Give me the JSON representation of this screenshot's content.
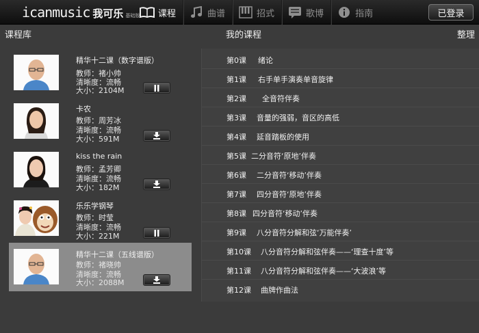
{
  "app": {
    "logo_text": "icanmusic",
    "logo_cn": "我可乐",
    "logo_sub": "基础版"
  },
  "nav": [
    {
      "label": "课程",
      "icon": "book-icon",
      "active": true
    },
    {
      "label": "曲谱",
      "icon": "music-note-icon",
      "active": false
    },
    {
      "label": "招式",
      "icon": "piano-keys-icon",
      "active": false
    },
    {
      "label": "歌博",
      "icon": "list-icon",
      "active": false
    },
    {
      "label": "指南",
      "icon": "info-icon",
      "active": false
    }
  ],
  "login_label": "已登录",
  "headers": {
    "library": "课程库",
    "my_courses": "我的课程",
    "organize": "整理"
  },
  "courses": [
    {
      "title": "精华十二课（数字谱版）",
      "teacher": "教师：褚小帅",
      "quality": "清晰度：流畅",
      "size": "大小：2104M",
      "action": "pause",
      "action_icon": "pause-icon",
      "selected": false
    },
    {
      "title": "卡农",
      "teacher": "教师：周芳冰",
      "quality": "清晰度：流畅",
      "size": "大小：591M",
      "action": "download",
      "action_icon": "download-icon",
      "selected": false
    },
    {
      "title": "kiss the rain",
      "teacher": "教师：孟芳卿",
      "quality": "清晰度：流畅",
      "size": "大小：182M",
      "action": "download",
      "action_icon": "download-icon",
      "selected": false
    },
    {
      "title": "乐乐学钢琴",
      "teacher": "教师：时莹",
      "quality": "清晰度：流畅",
      "size": "大小：221M",
      "action": "pause",
      "action_icon": "pause-icon",
      "selected": false
    },
    {
      "title": "精华十二课（五线谱版）",
      "teacher": "教师：褚晓帅",
      "quality": "清晰度：流畅",
      "size": "大小：2088M",
      "action": "download",
      "action_icon": "download-icon",
      "selected": true
    }
  ],
  "lessons": [
    {
      "num": "第0课",
      "name": "绪论"
    },
    {
      "num": "第1课",
      "name": "右手单手演奏单音旋律"
    },
    {
      "num": "第2课",
      "name": "全音符伴奏"
    },
    {
      "num": "第3课",
      "name": "音量的强弱，音区的高低"
    },
    {
      "num": "第4课",
      "name": "延音踏板的使用"
    },
    {
      "num": "第5课",
      "name": "二分音符‘原地’伴奏"
    },
    {
      "num": "第6课",
      "name": "二分音符‘移动’伴奏"
    },
    {
      "num": "第7课",
      "name": "四分音符‘原地’伴奏"
    },
    {
      "num": "第8课",
      "name": "四分音符‘移动’伴奏"
    },
    {
      "num": "第9课",
      "name": "八分音符分解和弦‘万能伴奏’"
    },
    {
      "num": "第10课",
      "name": "八分音符分解和弦伴奏——‘理查十度’等"
    },
    {
      "num": "第11课",
      "name": "八分音符分解和弦伴奏——‘大波浪’等"
    },
    {
      "num": "第12课",
      "name": "曲牌作曲法"
    }
  ]
}
